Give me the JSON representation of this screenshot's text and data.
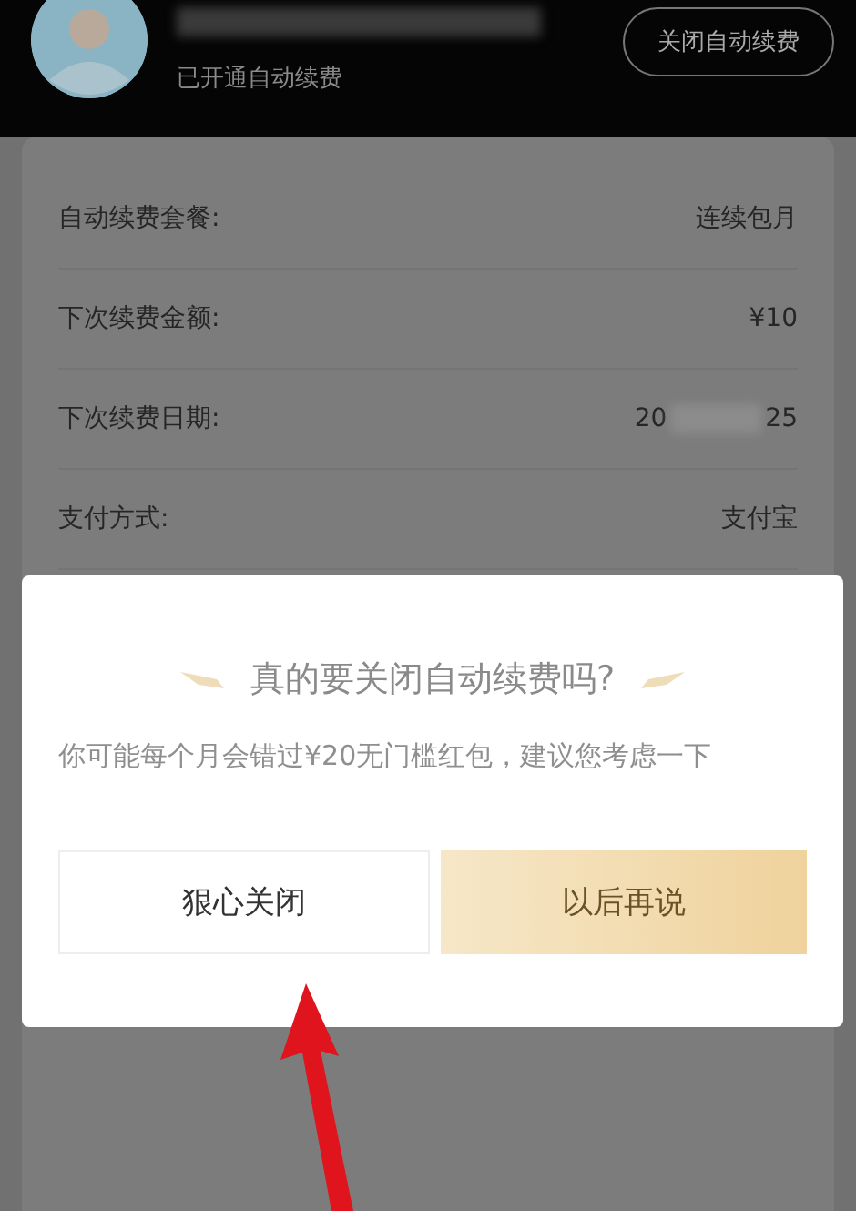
{
  "header": {
    "status": "已开通自动续费",
    "close_button": "关闭自动续费"
  },
  "details": [
    {
      "label": "自动续费套餐:",
      "value": "连续包月"
    },
    {
      "label": "下次续费金额:",
      "value": "¥10"
    },
    {
      "label": "下次续费日期:",
      "value": "20",
      "value_end": "25",
      "kind": "redacted"
    },
    {
      "label": "支付方式:",
      "value": "支付宝"
    }
  ],
  "dialog": {
    "title": "真的要关闭自动续费吗?",
    "message": "你可能每个月会错过¥20无门槛红包，建议您考虑一下",
    "buttons": [
      {
        "label": "狠心关闭",
        "kind": "secondary"
      },
      {
        "label": "以后再说",
        "kind": "primary"
      }
    ]
  }
}
